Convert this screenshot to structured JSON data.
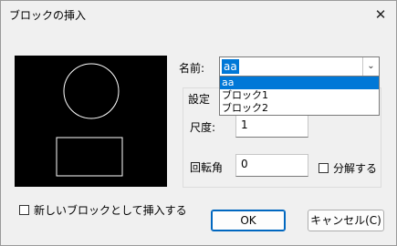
{
  "window": {
    "title": "ブロックの挿入"
  },
  "name": {
    "label": "名前:",
    "value": "aa",
    "options": [
      "aa",
      "ブロック1",
      "ブロック2"
    ],
    "highlighted_option": "aa"
  },
  "settings": {
    "label": "設定",
    "scale_label": "尺度:",
    "scale_value": "1",
    "rotation_label": "回転角",
    "rotation_value": "0",
    "explode_label": "分解する"
  },
  "new_block_label": "新しいブロックとして挿入する",
  "buttons": {
    "ok": "OK",
    "cancel": "キャンセル(C)"
  },
  "colors": {
    "accent": "#0078d7",
    "preview_bg": "#000000",
    "preview_stroke": "#ffffff"
  }
}
